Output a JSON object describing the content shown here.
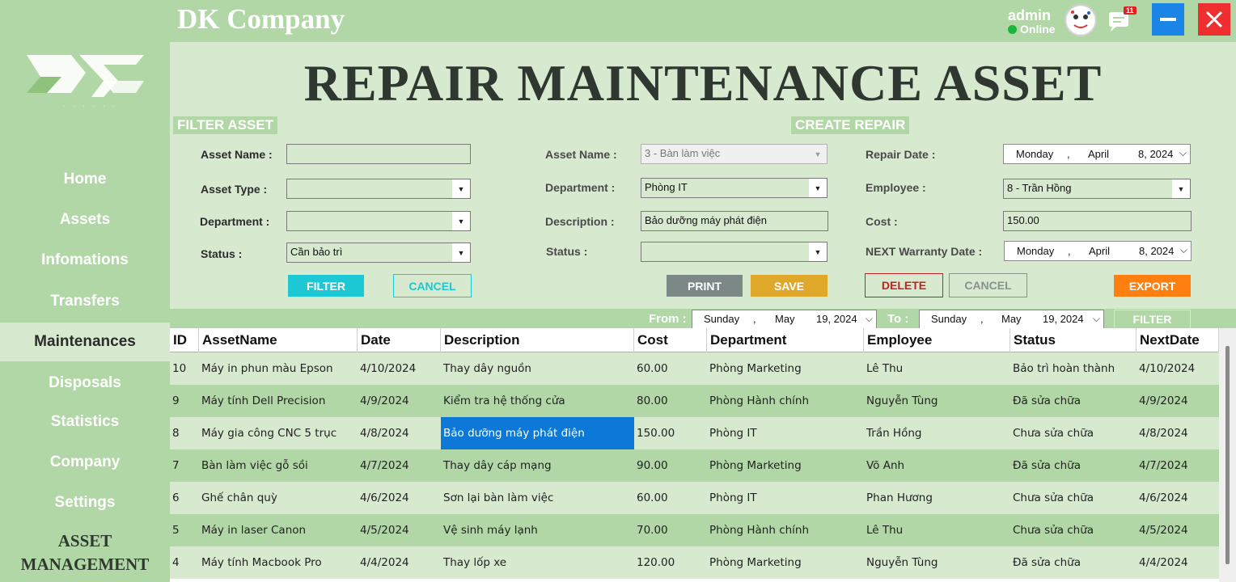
{
  "header": {
    "brand": "DK Company",
    "user_name": "admin",
    "user_status": "Online",
    "notification_count": "11"
  },
  "sidebar": {
    "items": [
      {
        "label": "Home"
      },
      {
        "label": "Assets"
      },
      {
        "label": "Infomations"
      },
      {
        "label": "Transfers"
      },
      {
        "label": "Maintenances",
        "active": true
      },
      {
        "label": "Disposals"
      },
      {
        "label": "Statistics"
      },
      {
        "label": "Company"
      },
      {
        "label": "Settings"
      }
    ],
    "footer_line1": "ASSET",
    "footer_line2": "MANAGEMENT"
  },
  "page": {
    "title": "REPAIR MAINTENANCE ASSET"
  },
  "filter": {
    "title": "FILTER ASSET",
    "asset_name_label": "Asset Name :",
    "asset_name_value": "",
    "asset_type_label": "Asset Type :",
    "asset_type_value": "",
    "department_label": "Department :",
    "department_value": "",
    "status_label": "Status :",
    "status_value": "Cần bảo trì",
    "filter_button": "FILTER",
    "cancel_button": "CANCEL"
  },
  "create": {
    "title": "CREATE REPAIR",
    "asset_name_label": "Asset Name :",
    "asset_name_value": "3 - Bàn làm việc",
    "department_label": "Department :",
    "department_value": "Phòng IT",
    "description_label": "Description :",
    "description_value": "Bảo dưỡng máy phát điện",
    "status_label": "Status :",
    "status_value": "",
    "repair_date_label": "Repair Date :",
    "repair_date": {
      "day": "Monday",
      "month": "April",
      "date": "8, 2024"
    },
    "employee_label": "Employee :",
    "employee_value": "8 - Trần Hồng",
    "cost_label": "Cost :",
    "cost_value": "150.00",
    "next_warranty_label": "NEXT Warranty Date :",
    "next_warranty_date": {
      "day": "Monday",
      "month": "April",
      "date": "8, 2024"
    },
    "print_button": "PRINT",
    "save_button": "SAVE",
    "delete_button": "DELETE",
    "cancel_button": "CANCEL",
    "export_button": "EXPORT"
  },
  "range": {
    "from_label": "From :",
    "from_date": {
      "day": "Sunday",
      "month": "May",
      "date": "19, 2024"
    },
    "to_label": "To :",
    "to_date": {
      "day": "Sunday",
      "month": "May",
      "date": "19, 2024"
    },
    "filter_button": "FILTER"
  },
  "table": {
    "columns": [
      "ID",
      "AssetName",
      "Date",
      "Description",
      "Cost",
      "Department",
      "Employee",
      "Status",
      "NextDate"
    ],
    "rows": [
      [
        "10",
        "Máy in phun màu Epson",
        "4/10/2024",
        "Thay dây nguồn",
        "60.00",
        "Phòng Marketing",
        "Lê Thu",
        "Bảo trì hoàn thành",
        "4/10/2024"
      ],
      [
        "9",
        "Máy tính Dell Precision",
        "4/9/2024",
        "Kiểm tra hệ thống cửa",
        "80.00",
        "Phòng Hành chính",
        "Nguyễn Tùng",
        "Đã sửa chữa",
        "4/9/2024"
      ],
      [
        "8",
        "Máy gia công CNC 5 trục",
        "4/8/2024",
        "Bảo dưỡng máy phát điện",
        "150.00",
        "Phòng IT",
        "Trần Hồng",
        "Chưa sửa chữa",
        "4/8/2024"
      ],
      [
        "7",
        "Bàn làm việc gỗ sồi",
        "4/7/2024",
        "Thay dây cáp mạng",
        "90.00",
        "Phòng Marketing",
        "Võ Anh",
        "Đã sửa chữa",
        "4/7/2024"
      ],
      [
        "6",
        "Ghế chân quỳ",
        "4/6/2024",
        "Sơn lại bàn làm việc",
        "60.00",
        "Phòng IT",
        "Phan Hương",
        "Chưa sửa chữa",
        "4/6/2024"
      ],
      [
        "5",
        "Máy in laser Canon",
        "4/5/2024",
        "Vệ sinh máy lạnh",
        "70.00",
        "Phòng Hành chính",
        "Lê Thu",
        "Chưa sửa chữa",
        "4/5/2024"
      ],
      [
        "4",
        "Máy tính Macbook Pro",
        "4/4/2024",
        "Thay lốp xe",
        "120.00",
        "Phòng Marketing",
        "Nguyễn Tùng",
        "Đã sửa chữa",
        "4/4/2024"
      ]
    ],
    "selected_row": 2,
    "selected_col": 3
  }
}
